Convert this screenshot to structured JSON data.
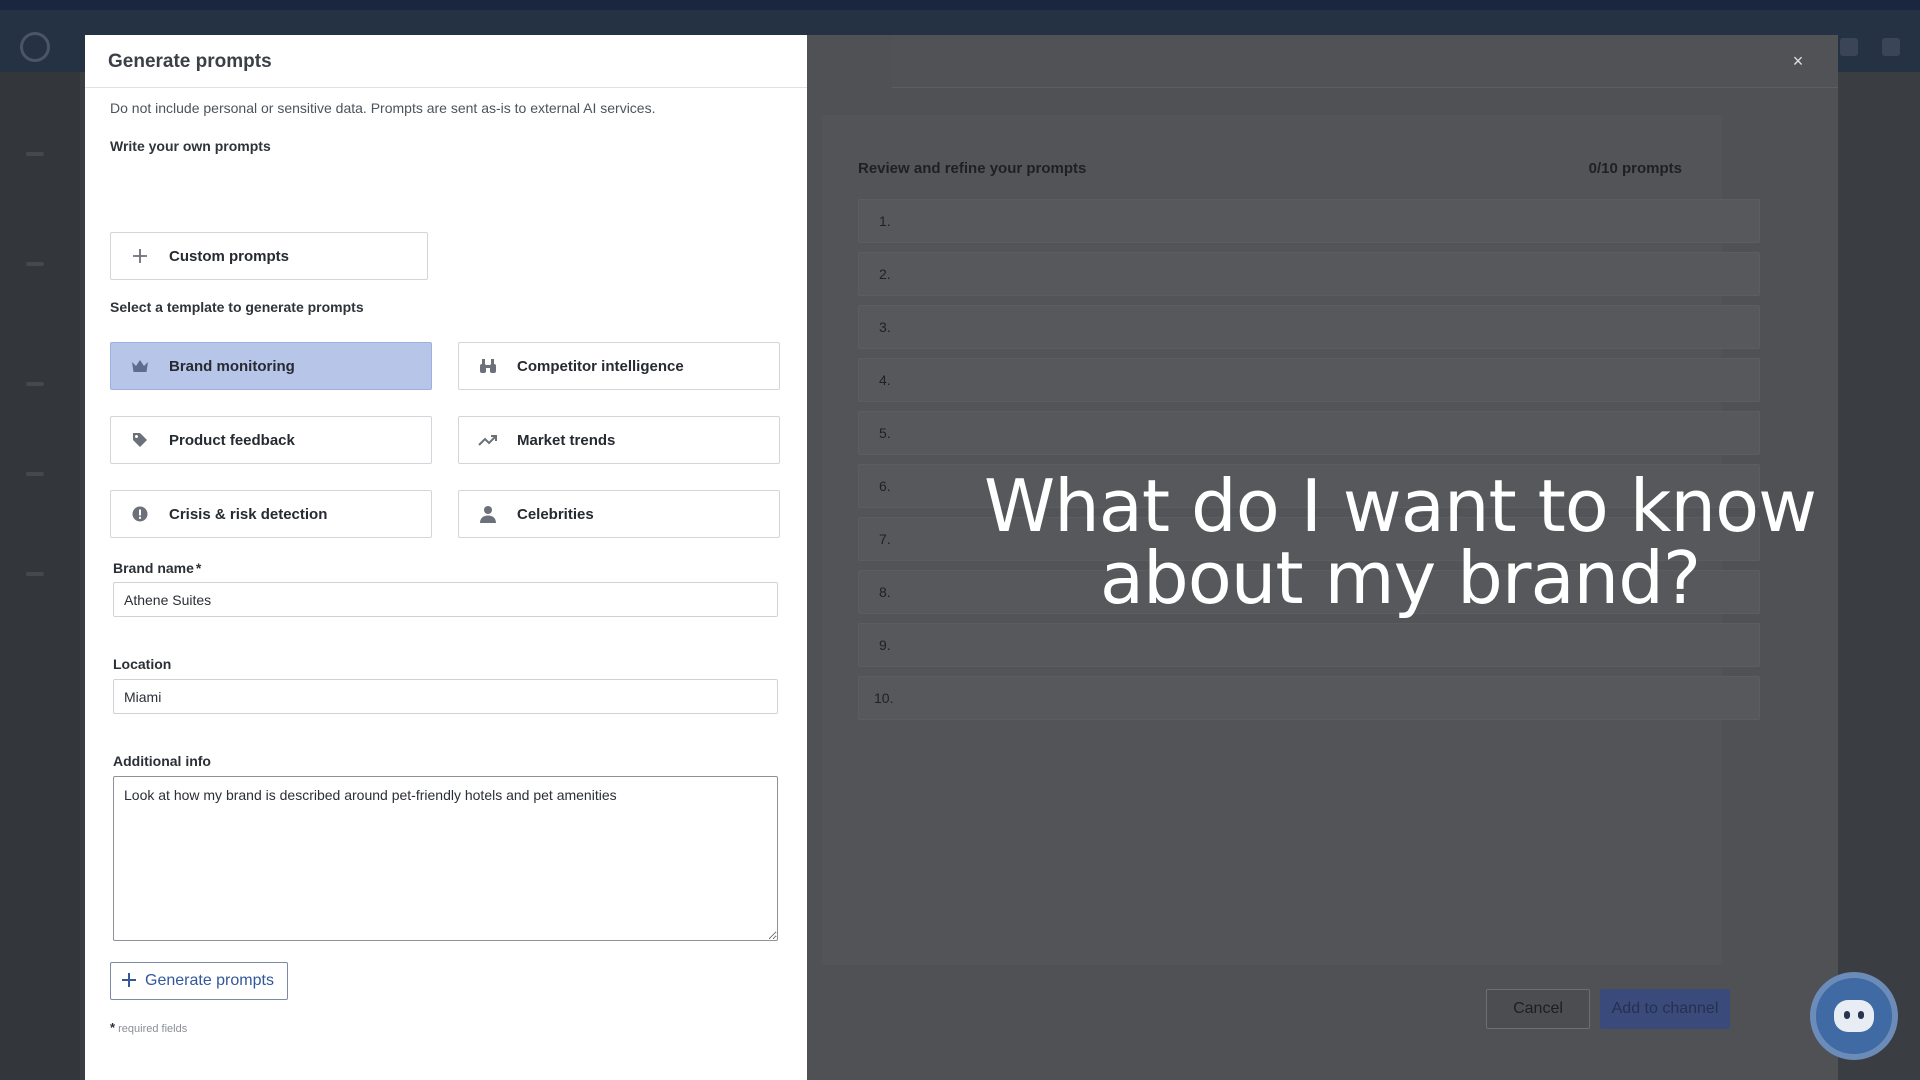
{
  "modal": {
    "title": "Generate prompts",
    "notice": "Do not include personal or sensitive data. Prompts are sent as-is to external AI services.",
    "write_own_title": "Write your own prompts",
    "custom_prompts_label": "Custom prompts",
    "template_title": "Select a template to generate prompts",
    "templates": [
      {
        "label": "Brand monitoring",
        "icon": "crown-icon",
        "selected": true
      },
      {
        "label": "Competitor intelligence",
        "icon": "binoculars-icon",
        "selected": false
      },
      {
        "label": "Product feedback",
        "icon": "tag-icon",
        "selected": false
      },
      {
        "label": "Market trends",
        "icon": "trending-up-icon",
        "selected": false
      },
      {
        "label": "Crisis & risk detection",
        "icon": "alert-icon",
        "selected": false
      },
      {
        "label": "Celebrities",
        "icon": "person-icon",
        "selected": false
      }
    ],
    "brand_name": {
      "label": "Brand name",
      "required_mark": "*",
      "value": "Athene Suites"
    },
    "location": {
      "label": "Location",
      "value": "Miami"
    },
    "additional_info": {
      "label": "Additional info",
      "value": "Look at how my brand is described around pet-friendly hotels and pet amenities"
    },
    "generate_label": "Generate prompts",
    "required_mark": "*",
    "required_note": "required fields"
  },
  "review": {
    "title": "Review and refine your prompts",
    "count": "0/10 prompts",
    "rows": [
      "1.",
      "2.",
      "3.",
      "4.",
      "5.",
      "6.",
      "7.",
      "8.",
      "9.",
      "10."
    ]
  },
  "footer": {
    "cancel_label": "Cancel",
    "add_label": "Add to channel"
  },
  "overlay": {
    "line1": "What do I want to know",
    "line2": "about my brand?"
  },
  "close_symbol": "×",
  "colors": {
    "selected_template": "#b7c5e9",
    "generate_button_text": "#33579b",
    "overlay_dim": "#4f5155"
  }
}
